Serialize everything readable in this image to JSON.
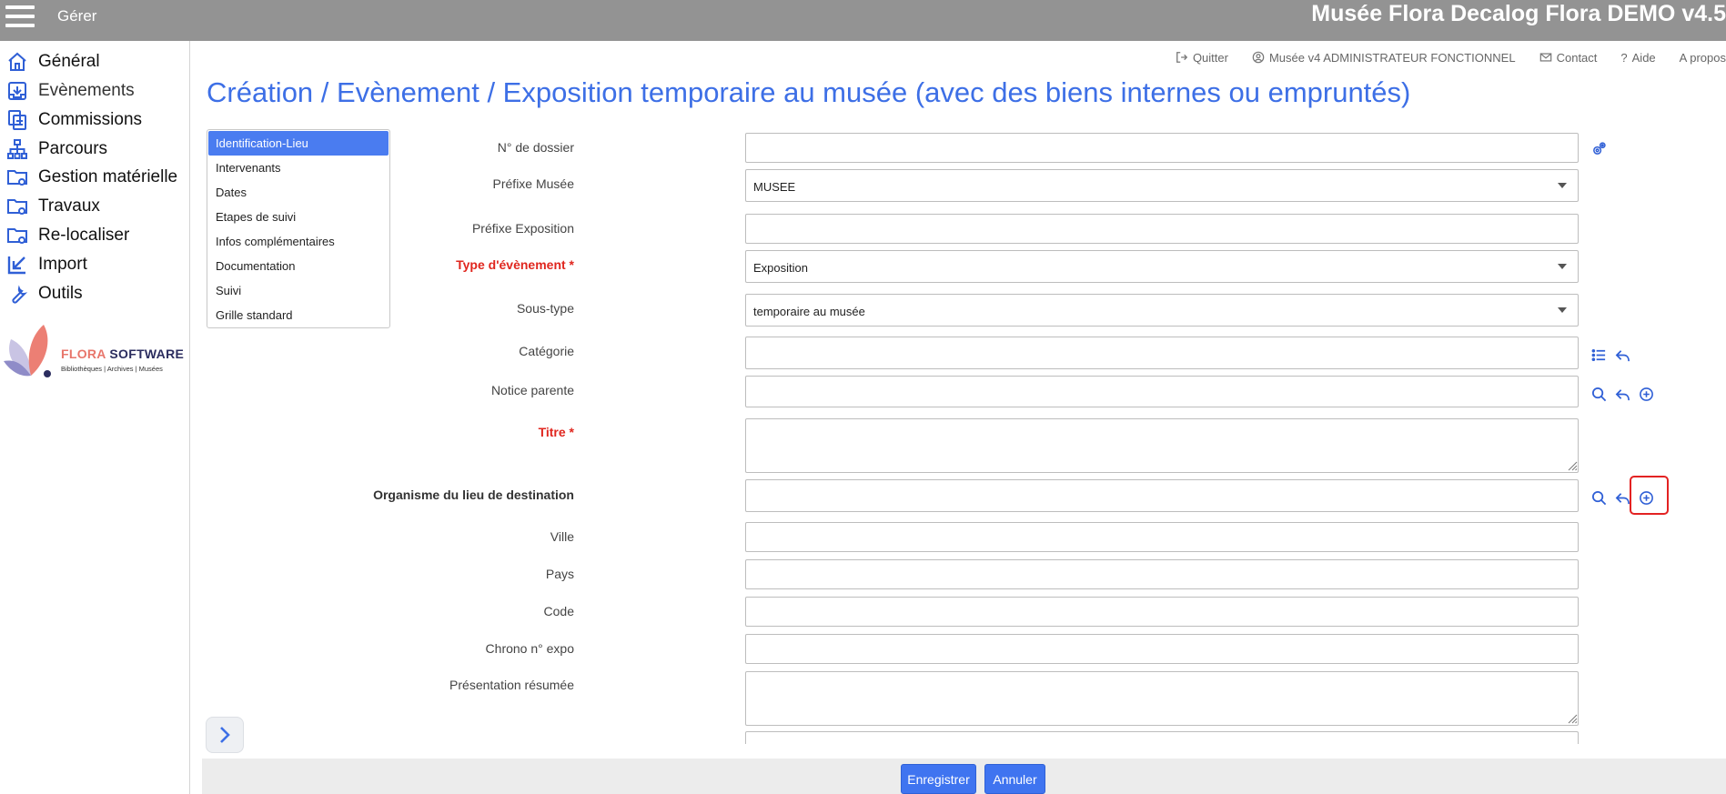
{
  "topbar": {
    "manage_label": "Gérer",
    "app_title": "Musée Flora Decalog Flora DEMO v4.5"
  },
  "sidebar": {
    "items": [
      {
        "label": "Général",
        "icon": "home-icon"
      },
      {
        "label": "Evènements",
        "icon": "inbox-download-icon"
      },
      {
        "label": "Commissions",
        "icon": "documents-icon"
      },
      {
        "label": "Parcours",
        "icon": "sitemap-icon"
      },
      {
        "label": "Gestion matérielle",
        "icon": "folder-gear-icon"
      },
      {
        "label": "Travaux",
        "icon": "folder-gear-icon"
      },
      {
        "label": "Re-localiser",
        "icon": "folder-gear-icon"
      },
      {
        "label": "Import",
        "icon": "arrow-import-icon"
      },
      {
        "label": "Outils",
        "icon": "wrench-icon"
      }
    ],
    "logo": {
      "brand_a": "FLORA",
      "brand_b": " SOFTWARE",
      "tagline": "Bibliothèques | Archives | Musées"
    }
  },
  "header_links": [
    {
      "label": "Quitter",
      "icon": "logout-icon"
    },
    {
      "label": "Musée v4 ADMINISTRATEUR FONCTIONNEL",
      "icon": "user-circle-icon"
    },
    {
      "label": "Contact",
      "icon": "envelope-icon"
    },
    {
      "label": "Aide",
      "icon": "question-icon"
    },
    {
      "label": "A propos",
      "icon": ""
    }
  ],
  "page_title": "Création / Evènement / Exposition temporaire au musée (avec des biens internes ou empruntés)",
  "tabs": [
    "Identification-Lieu",
    "Intervenants",
    "Dates",
    "Etapes de suivi",
    "Infos complémentaires",
    "Documentation",
    "Suivi",
    "Grille standard"
  ],
  "form": {
    "dossier": {
      "label": "N° de dossier",
      "value": ""
    },
    "prefixe_musee": {
      "label": "Préfixe Musée",
      "value": "MUSEE"
    },
    "prefixe_expo": {
      "label": "Préfixe Exposition",
      "value": ""
    },
    "type_evenement": {
      "label": "Type d'évènement *",
      "value": "Exposition"
    },
    "sous_type": {
      "label": "Sous-type",
      "value": "temporaire au musée"
    },
    "categorie": {
      "label": "Catégorie",
      "value": ""
    },
    "notice_parente": {
      "label": "Notice parente",
      "value": ""
    },
    "titre": {
      "label": "Titre *",
      "value": ""
    },
    "organisme": {
      "label": "Organisme du lieu de destination",
      "value": ""
    },
    "ville": {
      "label": "Ville",
      "value": ""
    },
    "pays": {
      "label": "Pays",
      "value": ""
    },
    "code": {
      "label": "Code",
      "value": ""
    },
    "chrono": {
      "label": "Chrono n° expo",
      "value": ""
    },
    "presentation": {
      "label": "Présentation résumée",
      "value": ""
    }
  },
  "buttons": {
    "save": "Enregistrer",
    "cancel": "Annuler"
  },
  "colors": {
    "accent": "#3d6fe6",
    "required": "#e0261e",
    "topbar": "#939393",
    "highlight": "#e32222"
  }
}
